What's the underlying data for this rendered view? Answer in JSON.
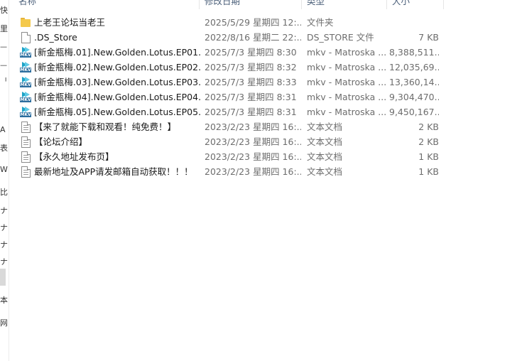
{
  "left_strip": {
    "glyphs": [
      "快",
      "里",
      "ᅳ",
      "ᅳ",
      "ᅵ",
      "A",
      "表",
      "W",
      "比",
      "ナ",
      "ナ",
      "ナ",
      "ナ",
      "本",
      "网"
    ]
  },
  "columns": {
    "name": "名称",
    "date": "修改日期",
    "type": "类型",
    "size": "大小"
  },
  "files": [
    {
      "icon": "folder-icon",
      "name": "上老王论坛当老王",
      "date": "2025/5/29 星期四 12:...",
      "type": "文件夹",
      "size": ""
    },
    {
      "icon": "document-icon",
      "name": ".DS_Store",
      "date": "2022/8/16 星期二 22:...",
      "type": "DS_STORE 文件",
      "size": "7 KB"
    },
    {
      "icon": "mkv-video-icon",
      "name": "[新金瓶梅.01].New.Golden.Lotus.EP01....",
      "date": "2025/7/3 星期四 8:30",
      "type": "mkv - Matroska ...",
      "size": "8,388,511..."
    },
    {
      "icon": "mkv-video-icon",
      "name": "[新金瓶梅.02].New.Golden.Lotus.EP02....",
      "date": "2025/7/3 星期四 8:32",
      "type": "mkv - Matroska ...",
      "size": "12,035,69..."
    },
    {
      "icon": "mkv-video-icon",
      "name": "[新金瓶梅.03].New.Golden.Lotus.EP03....",
      "date": "2025/7/3 星期四 8:33",
      "type": "mkv - Matroska ...",
      "size": "13,360,14..."
    },
    {
      "icon": "mkv-video-icon",
      "name": "[新金瓶梅.04].New.Golden.Lotus.EP04....",
      "date": "2025/7/3 星期四 8:31",
      "type": "mkv - Matroska ...",
      "size": "9,304,470..."
    },
    {
      "icon": "mkv-video-icon",
      "name": "[新金瓶梅.05].New.Golden.Lotus.EP05....",
      "date": "2025/7/3 星期四 8:31",
      "type": "mkv - Matroska ...",
      "size": "9,450,167..."
    },
    {
      "icon": "text-document-icon",
      "name": "【来了就能下载和观看！纯免费！】",
      "date": "2023/2/23 星期四 16:...",
      "type": "文本文档",
      "size": "2 KB"
    },
    {
      "icon": "text-document-icon",
      "name": "【论坛介绍】",
      "date": "2023/2/23 星期四 16:...",
      "type": "文本文档",
      "size": "2 KB"
    },
    {
      "icon": "text-document-icon",
      "name": "【永久地址发布页】",
      "date": "2023/2/23 星期四 16:...",
      "type": "文本文档",
      "size": "1 KB"
    },
    {
      "icon": "text-document-icon",
      "name": "最新地址及APP请发邮箱自动获取！！！",
      "date": "2023/2/23 星期四 16:...",
      "type": "文本文档",
      "size": "1 KB"
    }
  ]
}
